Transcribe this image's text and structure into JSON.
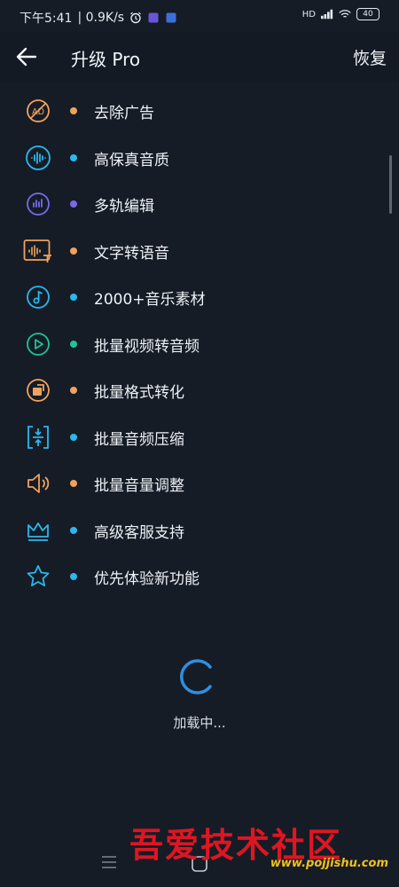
{
  "status": {
    "time": "下午5:41",
    "speed": "| 0.9K/s",
    "hd": "HD",
    "battery": "40"
  },
  "header": {
    "title": "升级 Pro",
    "restore": "恢复"
  },
  "features": [
    {
      "label": "去除广告",
      "icon": "no-ads-icon",
      "color": "#f0a25e"
    },
    {
      "label": "高保真音质",
      "icon": "waveform-icon",
      "color": "#2bb8ec"
    },
    {
      "label": "多轨编辑",
      "icon": "multitrack-icon",
      "color": "#7b69ea"
    },
    {
      "label": "文字转语音",
      "icon": "text-to-speech-icon",
      "color": "#f0a25e"
    },
    {
      "label": "2000+音乐素材",
      "icon": "music-note-icon",
      "color": "#2bb8ec"
    },
    {
      "label": "批量视频转音频",
      "icon": "video-to-audio-icon",
      "color": "#20c29a"
    },
    {
      "label": "批量格式转化",
      "icon": "format-convert-icon",
      "color": "#f0a25e"
    },
    {
      "label": "批量音频压缩",
      "icon": "compress-icon",
      "color": "#2bb8ec"
    },
    {
      "label": "批量音量调整",
      "icon": "volume-icon",
      "color": "#f0a25e"
    },
    {
      "label": "高级客服支持",
      "icon": "crown-icon",
      "color": "#2bb8ec"
    },
    {
      "label": "优先体验新功能",
      "icon": "star-icon",
      "color": "#2bb8ec"
    }
  ],
  "loading": {
    "text": "加载中..."
  },
  "watermark": {
    "title": "吾爱技术社区",
    "url": "www.pojjishu.com"
  },
  "colors": {
    "background": "#151c26",
    "accent_blue": "#2bb8ec",
    "accent_orange": "#f0a25e",
    "accent_purple": "#7b69ea",
    "accent_green": "#20c29a"
  }
}
